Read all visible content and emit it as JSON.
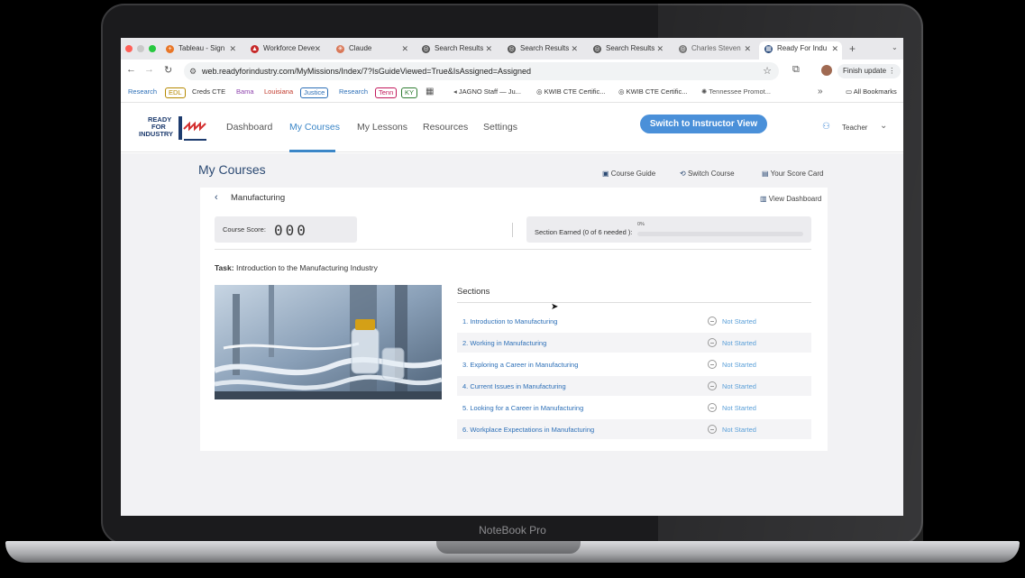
{
  "device": {
    "brand": "NoteBook Pro"
  },
  "browser": {
    "tabs": [
      {
        "label": "Tableau - Sign",
        "icon_color": "#e97627"
      },
      {
        "label": "Workforce Deve",
        "icon_color": "#c62828"
      },
      {
        "label": "Claude",
        "icon_color": "#d97757"
      },
      {
        "label": "Search Results",
        "icon_color": "#555555"
      },
      {
        "label": "Search Results",
        "icon_color": "#555555"
      },
      {
        "label": "Search Results",
        "icon_color": "#555555"
      },
      {
        "label": "Charles Steven",
        "icon_color": "#777777"
      },
      {
        "label": "Ready For Indu",
        "icon_color": "#2a4b7c"
      }
    ],
    "url": "web.readyforindustry.com/MyMissions/Index/7?IsGuideViewed=True&IsAssigned=Assigned",
    "finish_update": "Finish update",
    "bookmarks": [
      {
        "label": "Research",
        "color": "#2c6fb7",
        "pill": false
      },
      {
        "label": "EDL",
        "color": "#b58900",
        "pill": true
      },
      {
        "label": "Creds CTE",
        "color": "#333333",
        "pill": false
      },
      {
        "label": "Bama",
        "color": "#8e44ad",
        "pill": false
      },
      {
        "label": "Louisiana",
        "color": "#c0392b",
        "pill": false
      },
      {
        "label": "Justice",
        "color": "#2c6fb7",
        "pill": true
      },
      {
        "label": "Research",
        "color": "#2c6fb7",
        "pill": false
      },
      {
        "label": "Tenn",
        "color": "#c2185b",
        "pill": true
      },
      {
        "label": "KY",
        "color": "#2e7d32",
        "pill": true
      }
    ],
    "more_bookmarks": [
      "JAGNO Staff — Ju...",
      "KWIB CTE Certific...",
      "KWIB CTE Certific...",
      "Tennessee Promot..."
    ],
    "all_bookmarks": "All Bookmarks"
  },
  "app": {
    "logo": [
      "READY",
      "FOR",
      "INDUSTRY"
    ],
    "nav": [
      "Dashboard",
      "My Courses",
      "My Lessons",
      "Resources",
      "Settings"
    ],
    "instructor_button": "Switch to Instructor View",
    "user_role": "Teacher",
    "page_title": "My Courses",
    "toolbar": {
      "course_guide": "Course Guide",
      "switch_course": "Switch Course",
      "score_card": "Your Score Card"
    },
    "course_name": "Manufacturing",
    "view_dashboard": "View Dashboard",
    "course_score_label": "Course Score:",
    "course_score_value": "000",
    "section_earned_label": "Section Earned (0 of 6 needed ):",
    "section_earned_pct": "0%",
    "section_earned_fraction": 0,
    "task_label": "Task:",
    "task_title": "Introduction to the Manufacturing Industry",
    "sections_title": "Sections",
    "sections": [
      {
        "title": "1. Introduction to Manufacturing",
        "status": "Not Started"
      },
      {
        "title": "2. Working in Manufacturing",
        "status": "Not Started"
      },
      {
        "title": "3. Exploring a Career in Manufacturing",
        "status": "Not Started"
      },
      {
        "title": "4. Current Issues in Manufacturing",
        "status": "Not Started"
      },
      {
        "title": "5. Looking for a Career in Manufacturing",
        "status": "Not Started"
      },
      {
        "title": "6. Workplace Expectations in Manufacturing",
        "status": "Not Started"
      }
    ]
  }
}
